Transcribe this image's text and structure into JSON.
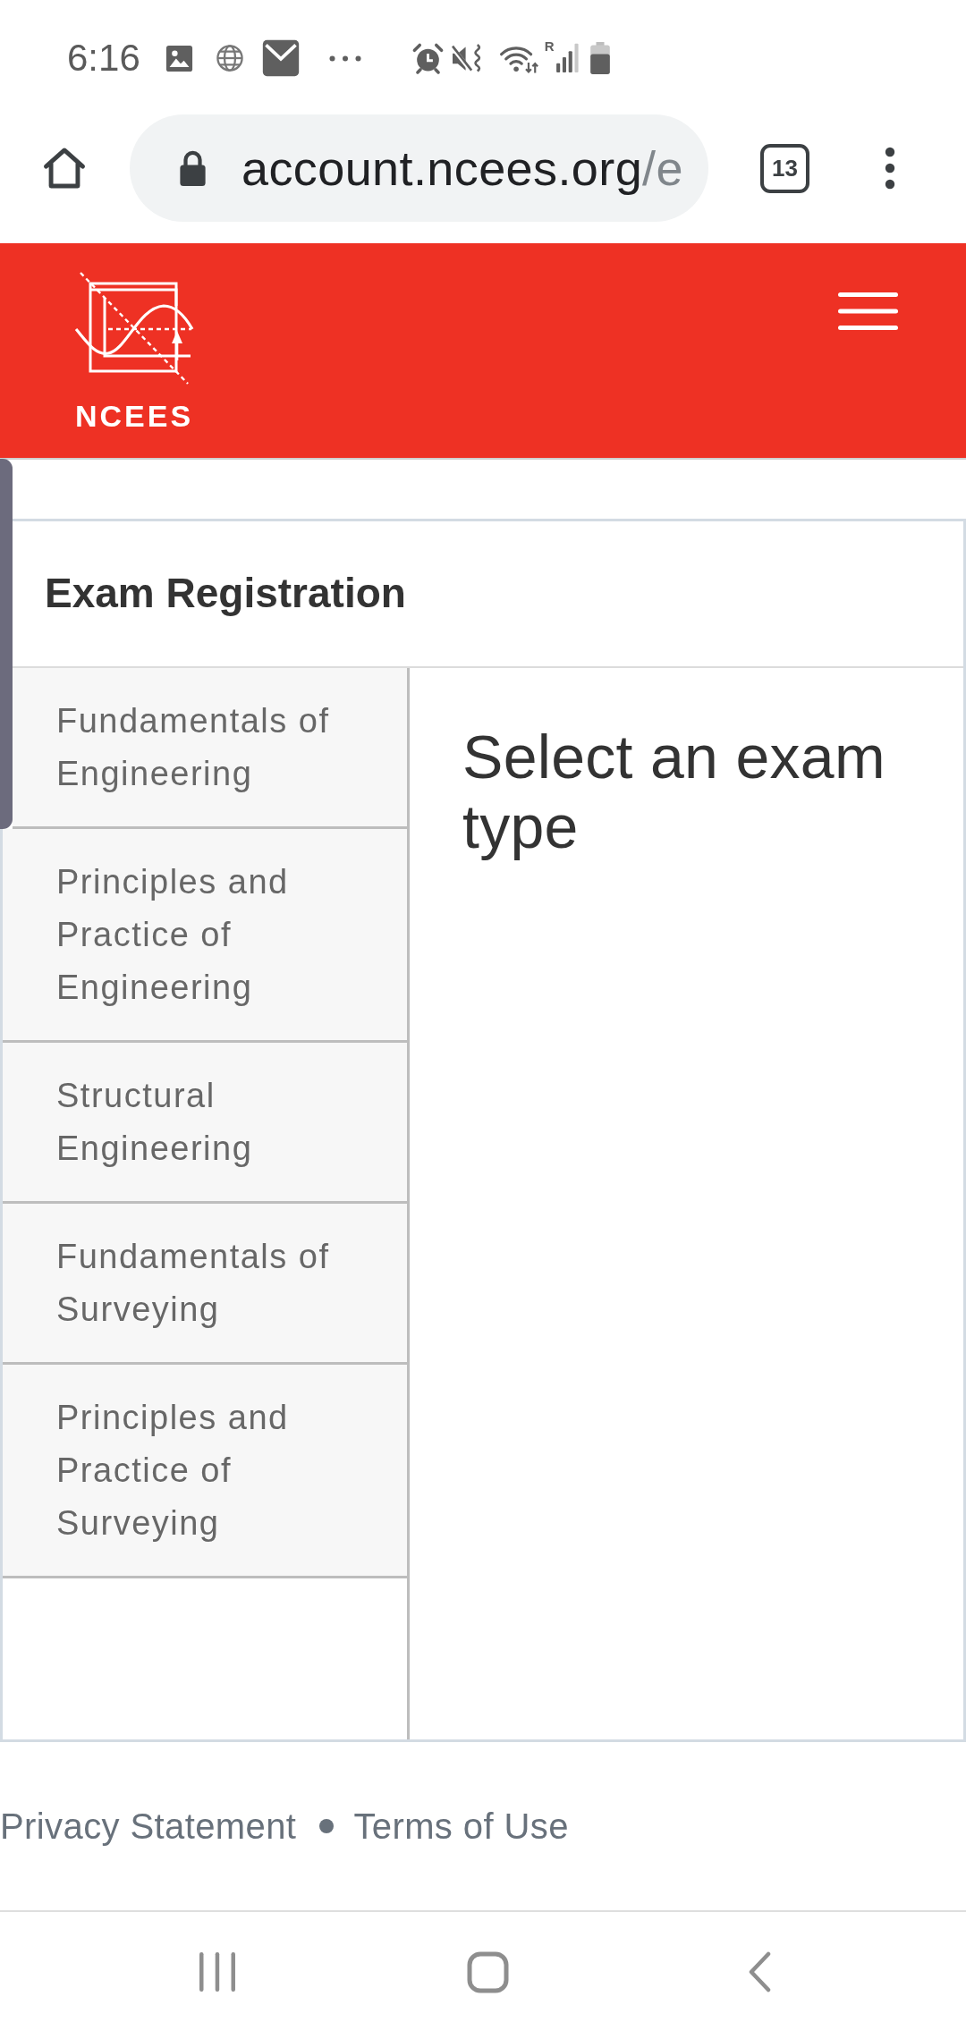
{
  "status_bar": {
    "time": "6:16",
    "roaming_mark": "R"
  },
  "browser": {
    "url_host": "account.ncees.org",
    "url_path": "/e",
    "tab_count": "13"
  },
  "site_header": {
    "logo_text": "NCEES"
  },
  "panel": {
    "title": "Exam Registration",
    "exam_types": [
      {
        "label": "Fundamentals of Engineering",
        "selected": false
      },
      {
        "label": "Principles and Practice of Engineering",
        "selected": false
      },
      {
        "label": "Structural Engineering",
        "selected": false
      },
      {
        "label": "Fundamentals of Surveying",
        "selected": false
      },
      {
        "label": "Principles and Practice of Surveying",
        "selected": false
      }
    ],
    "prompt": "Select an exam type"
  },
  "footer": {
    "links": [
      "Privacy Statement",
      "Terms of Use"
    ]
  }
}
